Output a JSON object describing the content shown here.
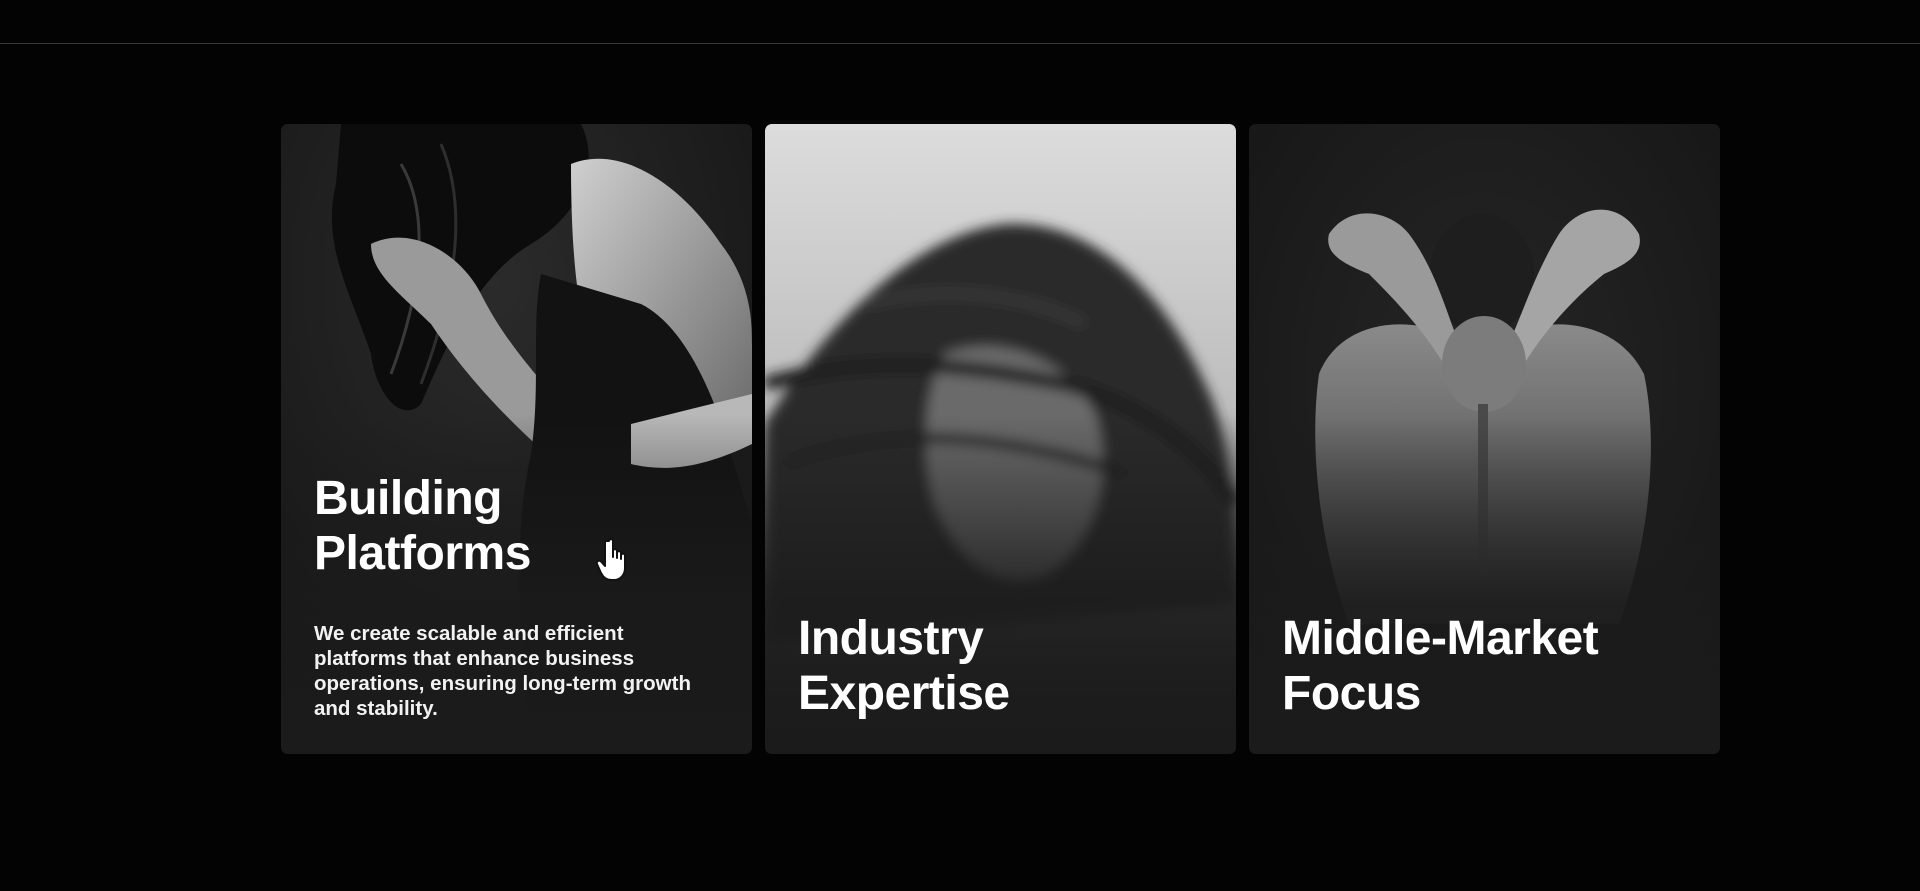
{
  "cards": [
    {
      "title": "Building\nPlatforms",
      "description": "We create scalable and efficient platforms that enhance business operations, ensuring long-term growth and stability.",
      "image": "woman-hair-dance-photo"
    },
    {
      "title": "Industry\nExpertise",
      "description": "",
      "image": "blurred-hair-motion-photo"
    },
    {
      "title": "Middle-Market\nFocus",
      "description": "",
      "image": "man-back-hands-photo"
    }
  ],
  "cursor": "hand-pointer-icon",
  "colors": {
    "background": "#030303",
    "card": "#1b1b1b",
    "text": "#ffffff"
  }
}
